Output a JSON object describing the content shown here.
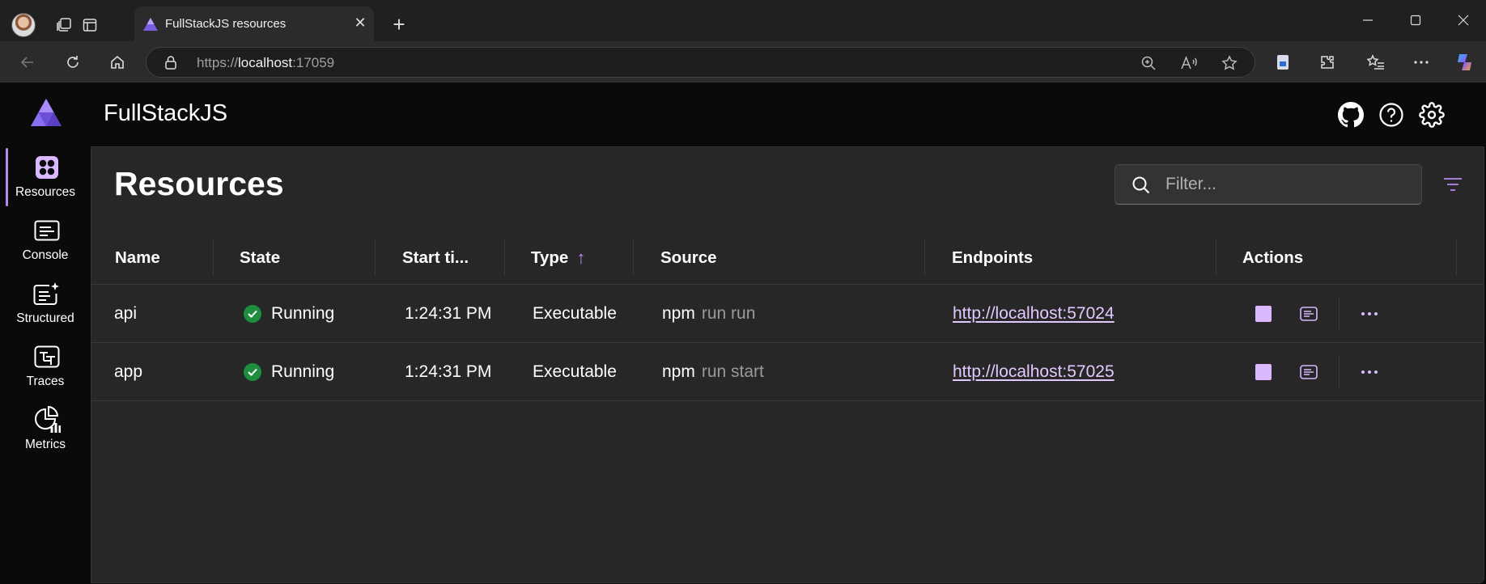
{
  "browser": {
    "tab_title": "FullStackJS resources",
    "url_scheme": "https://",
    "url_host": "localhost",
    "url_port": ":17059"
  },
  "app": {
    "title": "FullStackJS",
    "accent_color": "#b68bf0"
  },
  "sidenav": {
    "items": [
      {
        "label": "Resources",
        "icon": "resources-icon",
        "active": true
      },
      {
        "label": "Console",
        "icon": "console-icon",
        "active": false
      },
      {
        "label": "Structured",
        "icon": "structured-logs-icon",
        "active": false
      },
      {
        "label": "Traces",
        "icon": "traces-icon",
        "active": false
      },
      {
        "label": "Metrics",
        "icon": "metrics-icon",
        "active": false
      }
    ]
  },
  "page": {
    "title": "Resources",
    "filter_placeholder": "Filter..."
  },
  "table": {
    "columns": [
      "Name",
      "State",
      "Start ti...",
      "Type",
      "Source",
      "Endpoints",
      "Actions"
    ],
    "sort_column": "Type",
    "sort_direction": "ascending",
    "rows": [
      {
        "name": "api",
        "state": "Running",
        "start_time": "1:24:31 PM",
        "type": "Executable",
        "source_cmd": "npm",
        "source_args": "run run",
        "endpoint": "http://localhost:57024"
      },
      {
        "name": "app",
        "state": "Running",
        "start_time": "1:24:31 PM",
        "type": "Executable",
        "source_cmd": "npm",
        "source_args": "run start",
        "endpoint": "http://localhost:57025"
      }
    ]
  }
}
